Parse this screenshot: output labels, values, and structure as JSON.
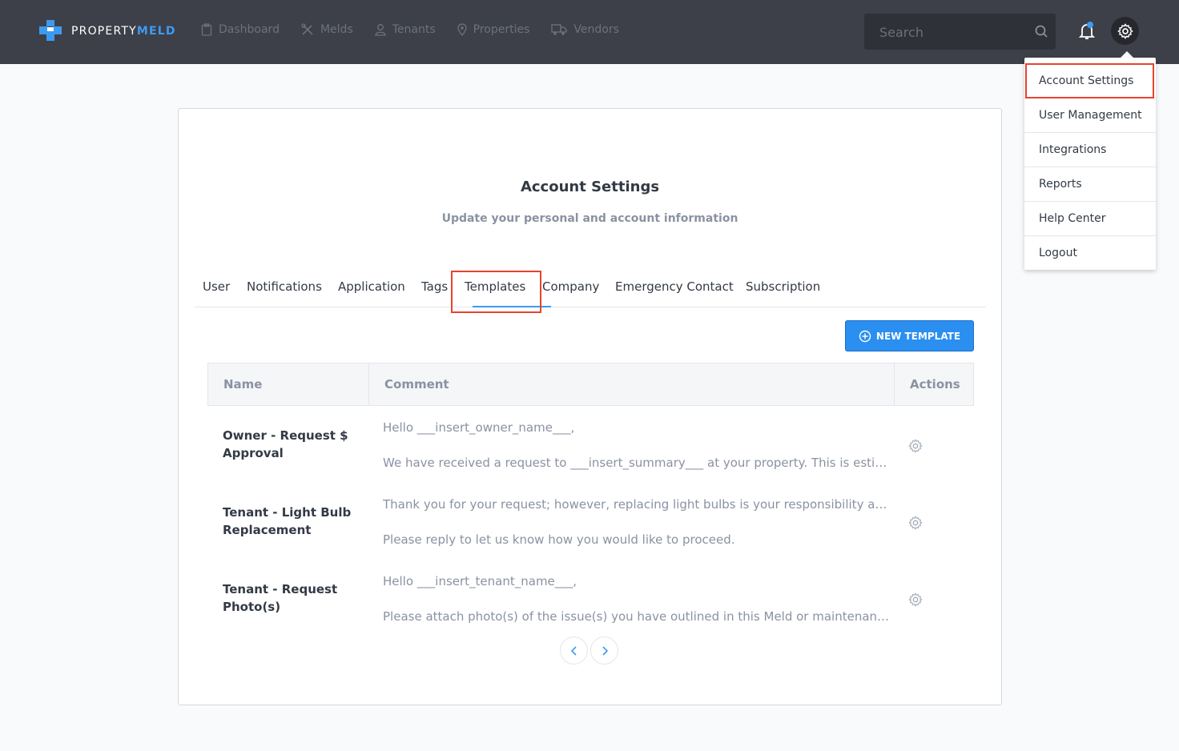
{
  "brand": {
    "name_part1": "PROPERTY",
    "name_part2": "MELD",
    "accent": "#3c9bf0"
  },
  "nav": {
    "items": [
      {
        "label": "Dashboard",
        "icon": "clipboard-icon"
      },
      {
        "label": "Melds",
        "icon": "tools-icon"
      },
      {
        "label": "Tenants",
        "icon": "user-icon"
      },
      {
        "label": "Properties",
        "icon": "location-pin-icon"
      },
      {
        "label": "Vendors",
        "icon": "truck-icon"
      }
    ]
  },
  "search": {
    "placeholder": "Search"
  },
  "dropdown": {
    "items": [
      {
        "label": "Account Settings"
      },
      {
        "label": "User Management"
      },
      {
        "label": "Integrations"
      },
      {
        "label": "Reports"
      },
      {
        "label": "Help Center"
      },
      {
        "label": "Logout"
      }
    ]
  },
  "page": {
    "title": "Account Settings",
    "subtitle": "Update your personal and account information"
  },
  "tabs": [
    {
      "label": "User"
    },
    {
      "label": "Notifications"
    },
    {
      "label": "Application"
    },
    {
      "label": "Tags"
    },
    {
      "label": "Templates"
    },
    {
      "label": "Company"
    },
    {
      "label": "Emergency Contact"
    },
    {
      "label": "Subscription"
    }
  ],
  "new_template_label": "NEW TEMPLATE",
  "table": {
    "headers": {
      "name": "Name",
      "comment": "Comment",
      "actions": "Actions"
    },
    "rows": [
      {
        "name": "Owner - Request $ Approval",
        "comment_line1": "Hello ___insert_owner_name___,",
        "comment_line2": "We have received a request to ___insert_summary___ at your property.  This is estimated to cost..."
      },
      {
        "name": "Tenant - Light Bulb Replacement",
        "comment_line1": "Thank you for your request; however, replacing light bulbs is your responsibility as ...",
        "comment_line2": "Please reply to let us know how you would like to proceed."
      },
      {
        "name": "Tenant - Request Photo(s)",
        "comment_line1": "Hello ___insert_tenant_name___,",
        "comment_line2": "Please attach photo(s) of the issue(s) you have outlined in this Meld or maintenance request..."
      }
    ]
  }
}
